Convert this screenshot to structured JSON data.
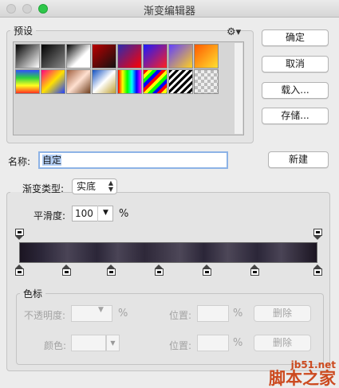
{
  "window": {
    "title": "渐变编辑器"
  },
  "presets": {
    "label": "预设",
    "gear_icon": "gear-icon",
    "swatches_row1": [
      "linear-gradient(135deg,#000,#fff)",
      "linear-gradient(135deg,#000,#888)",
      "linear-gradient(135deg,#000 0%,#fff 60%,#fff)",
      "linear-gradient(135deg,#b00,#111)",
      "linear-gradient(135deg,#2b2bb0,#ff0000)",
      "linear-gradient(135deg,#1a1aff,#ff2020)",
      "linear-gradient(135deg,#6040ff,#ffd020)",
      "linear-gradient(135deg,#ff5a00,#ffe030)"
    ],
    "swatches_row2": [
      "linear-gradient(180deg,#3050ff,#30d040,#ffff20,#ff3020)",
      "linear-gradient(135deg,#ff0080,#ffe000,#2040ff)",
      "linear-gradient(135deg,#a06040,#ffe0d0,#704020)",
      "linear-gradient(135deg,#1050c0,#ffffff,#c0a030)",
      "linear-gradient(90deg,#ff0000,#ffff00,#00ff00,#00ffff,#0000ff,#ff00ff)",
      "repeating-linear-gradient(135deg,#ff0000 0 4px,#ffff00 4px 8px,#00ff00 8px 12px,#0000ff 12px 16px)",
      "repeating-linear-gradient(135deg,#000 0 3px,#fff 3px 6px)",
      "repeating-conic-gradient(#bbb 0 25%,#eee 0 50%) 0 0/8px 8px"
    ]
  },
  "buttons": {
    "ok": "确定",
    "cancel": "取消",
    "load": "载入...",
    "save": "存储...",
    "new": "新建"
  },
  "name": {
    "label": "名称:",
    "value": "自定"
  },
  "type": {
    "label": "渐变类型:",
    "value": "实底"
  },
  "smoothness": {
    "label": "平滑度:",
    "value": "100",
    "unit": "%"
  },
  "stops": {
    "group_label": "色标",
    "opacity_label": "不透明度:",
    "opacity_unit": "%",
    "location_label": "位置:",
    "location_unit": "%",
    "delete_label": "删除",
    "color_label": "颜色:",
    "opacity_stop_positions": [
      0,
      100
    ],
    "color_stop_positions": [
      0,
      16,
      31,
      47,
      63,
      79,
      100
    ]
  },
  "watermark": {
    "url": "jb51.net",
    "text": "脚本之家"
  }
}
